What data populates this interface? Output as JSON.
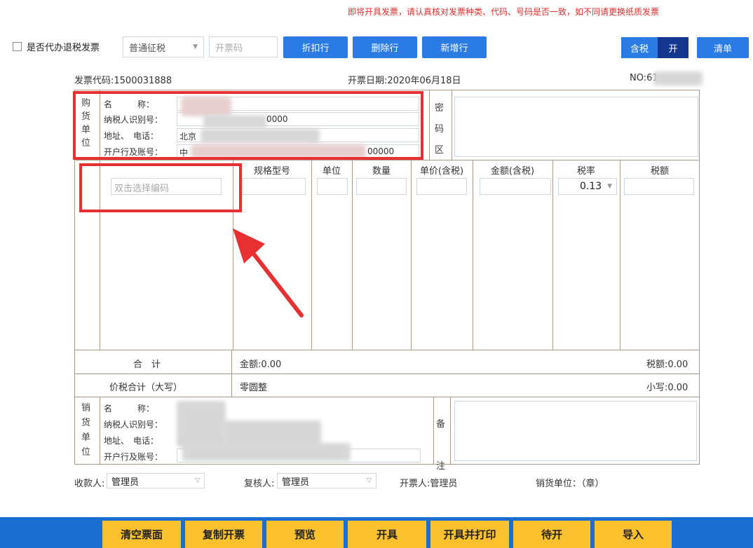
{
  "notice": "即将开具发票，请认真核对发票种类、代码、号码是否一致，如不同请更换纸质发票",
  "toolbar": {
    "agent_checkbox_label": "是否代办退税发票",
    "tax_type_select": "普通征税",
    "invoice_code_placeholder": "开票码",
    "btn_discount_row": "折扣行",
    "btn_delete_row": "删除行",
    "btn_add_row": "新增行",
    "tax_included_label": "含税",
    "tax_included_state": "开",
    "btn_list": "清单"
  },
  "header": {
    "invoice_code": "发票代码:1500031888",
    "issue_date": "开票日期:2020年06月18日",
    "number": "NO:61"
  },
  "buyer": {
    "vertical_label": [
      "购",
      "货",
      "单",
      "位"
    ],
    "name_label": "名　　　称：",
    "tax_id_label": "纳税人识别号：",
    "tax_id_partial": "0000",
    "address_label": "地址、　电话：",
    "address_partial": "北京",
    "bank_label": "开户行及账号：",
    "bank_partial": "中",
    "bank_tail": "00000"
  },
  "cipher": {
    "vertical_label": [
      "密",
      "码",
      "区"
    ]
  },
  "columns": {
    "spec": "规格型号",
    "unit": "单位",
    "quantity": "数量",
    "unit_price": "单价(含税)",
    "amount": "金额(含税)",
    "tax_rate": "税率",
    "tax_amount": "税额"
  },
  "item_row": {
    "name_placeholder": "双击选择编码",
    "tax_rate_value": "0.13"
  },
  "totals": {
    "total_label": "合　计",
    "amount": "金额:0.00",
    "tax": "税额:0.00",
    "total_with_tax_label": "价税合计（大写）",
    "total_upper": "零圆整",
    "total_lower": "小写:0.00"
  },
  "seller": {
    "vertical_label": [
      "销",
      "货",
      "单",
      "位"
    ],
    "name_label": "名　　　称：",
    "tax_id_label": "纳税人识别号：",
    "address_label": "地址、　电话：",
    "bank_label": "开户行及账号："
  },
  "remarks": {
    "vertical_label": [
      "备",
      "注"
    ]
  },
  "footer": {
    "payee_label": "收款人:",
    "payee_value": "管理员",
    "reviewer_label": "复核人:",
    "reviewer_value": "管理员",
    "issuer": "开票人:管理员",
    "seller_stamp": "销货单位：（章）"
  },
  "actions": {
    "clear": "清空票面",
    "copy": "复制开票",
    "preview": "预览",
    "issue": "开具",
    "issue_print": "开具并打印",
    "pending": "待开",
    "import": "导入"
  },
  "colors": {
    "primary_button": "#2b7be4",
    "toggle_on": "#13368e",
    "bottom_bar": "#1a6ed0",
    "action_button": "#fbc02d",
    "highlight": "#e63032",
    "notice_text": "#e02d2d"
  }
}
